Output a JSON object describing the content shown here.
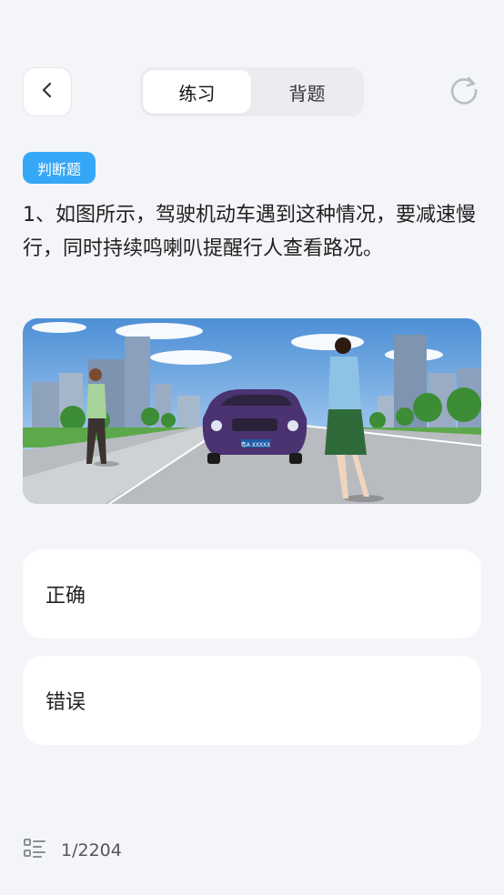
{
  "header": {
    "tabs": [
      {
        "label": "练习",
        "active": true
      },
      {
        "label": "背题",
        "active": false
      }
    ],
    "icons": {
      "back": "chevron-left-icon",
      "refresh": "refresh-icon"
    }
  },
  "question": {
    "type_badge": "判断题",
    "text": "1、如图所示，驾驶机动车遇到这种情况，要减速慢行，同时持续鸣喇叭提醒行人查看路况。",
    "image": {
      "description": "car-road-pedestrians-illustration",
      "plate_text": "粤A XXXXX"
    }
  },
  "options": [
    {
      "label": "正确"
    },
    {
      "label": "错误"
    }
  ],
  "footer": {
    "icon": "question-list-icon",
    "progress": "1/2204"
  },
  "colors": {
    "background": "#f4f5f8",
    "badge": "#35a7f7",
    "card": "#ffffff",
    "segment_bg": "#ebecf0"
  }
}
